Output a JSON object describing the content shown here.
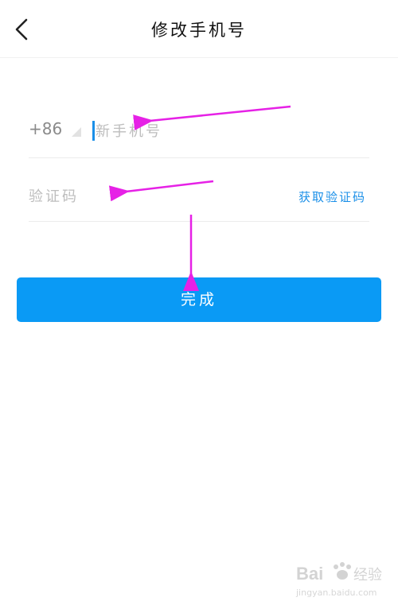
{
  "header": {
    "title": "修改手机号",
    "back_icon": "chevron-left-icon"
  },
  "form": {
    "country_code": "+86",
    "phone_placeholder": "新手机号",
    "code_placeholder": "验证码",
    "get_code_label": "获取验证码"
  },
  "actions": {
    "done_label": "完成"
  },
  "colors": {
    "accent": "#0a9af5",
    "link": "#1a8fe8",
    "annotation_arrow": "#e621e6"
  },
  "watermark": {
    "logo_text": "Bai 经验",
    "url": "jingyan.baidu.com"
  }
}
